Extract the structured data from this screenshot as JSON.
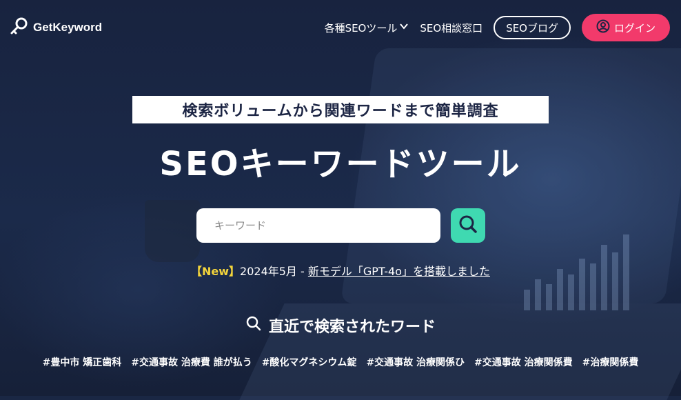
{
  "header": {
    "logo_text": "GetKeyword",
    "nav": {
      "tools_label": "各種SEOツール",
      "consult_label": "SEO相談窓口",
      "blog_label": "SEOブログ",
      "login_label": "ログイン"
    }
  },
  "hero": {
    "tagline": "検索ボリュームから関連ワードまで簡単調査",
    "title": "SEOキーワードツール",
    "search_placeholder": "キーワード",
    "search_value": "",
    "news_tag": "【New】",
    "news_date": "2024年5月 - ",
    "news_link": "新モデル「GPT-4o」を搭載しました"
  },
  "recent": {
    "title": "直近で検索されたワード",
    "tags": [
      "#豊中市 矯正歯科",
      "#交通事故 治療費 誰が払う",
      "#酸化マグネシウム錠",
      "#交通事故 治療関係ひ",
      "#交通事故 治療関係費",
      "#治療関係費"
    ]
  },
  "colors": {
    "background": "#1a2744",
    "login_button": "#f23a6b",
    "search_button": "#3fd9b1",
    "news_tag": "#f3d43b"
  }
}
